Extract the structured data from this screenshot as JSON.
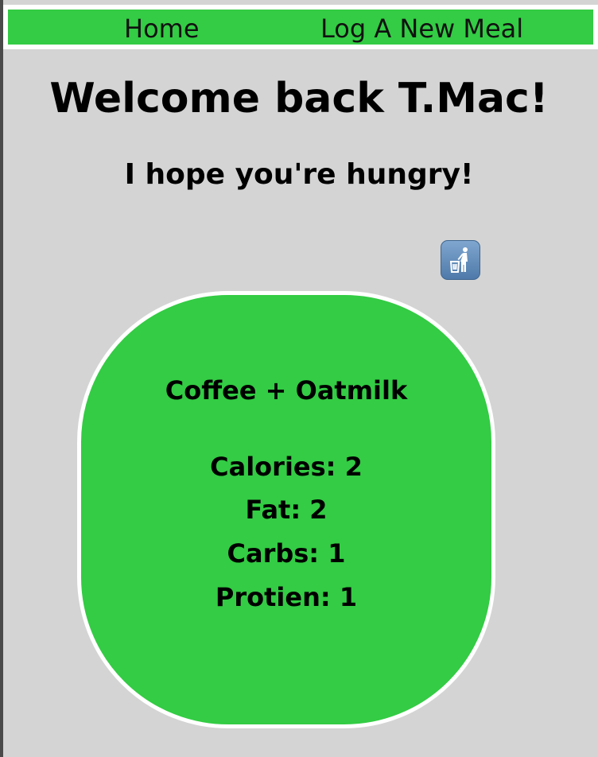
{
  "nav": {
    "home_label": "Home",
    "log_meal_label": "Log A New Meal"
  },
  "header": {
    "welcome": "Welcome back T.Mac!",
    "subtitle": "I hope you're hungry!"
  },
  "actions": {
    "delete_icon": "trash-icon"
  },
  "meal": {
    "name": "Coffee + Oatmilk",
    "calories": "Calories: 2",
    "fat": "Fat: 2",
    "carbs": "Carbs: 1",
    "protein": "Protien: 1"
  },
  "colors": {
    "page_background": "#d4d4d4",
    "accent_green": "#33cc44",
    "card_border": "#ffffff",
    "trash_button": "#5f89b8"
  }
}
